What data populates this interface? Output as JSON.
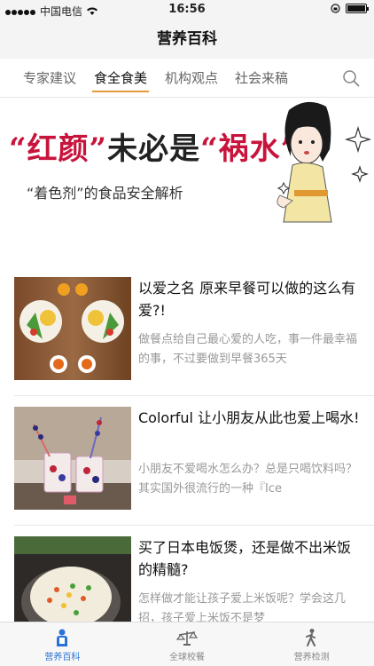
{
  "status_bar": {
    "carrier": "中国电信",
    "time": "16:56"
  },
  "nav": {
    "title": "营养百科"
  },
  "tabs": [
    {
      "label": "专家建议"
    },
    {
      "label": "食全食美"
    },
    {
      "label": "机构观点"
    },
    {
      "label": "社会来稿"
    }
  ],
  "banner": {
    "title_part1": "“红颜”",
    "title_part2": "未必是",
    "title_part3": "“祸水”",
    "subtitle": "“着色剂”的食品安全解析"
  },
  "articles": [
    {
      "title": "以爱之名 原来早餐可以做的这么有爱?!",
      "desc": "做餐点给自己最心爱的人吃，事一件最幸福的事，不过要做到早餐365天"
    },
    {
      "title": "Colorful 让小朋友从此也爱上喝水!",
      "desc": "小朋友不爱喝水怎么办？总是只喝饮料吗？其实国外很流行的一种『Ice"
    },
    {
      "title": "买了日本电饭煲，还是做不出米饭的精髓?",
      "desc": "怎样做才能让孩子爱上米饭呢？学会这几招，孩子爱上米饭不是梦"
    }
  ],
  "bottom_tabs": [
    {
      "label": "营养百科",
      "icon": "person-icon"
    },
    {
      "label": "全球校餐",
      "icon": "scale-icon"
    },
    {
      "label": "营养检测",
      "icon": "walker-icon"
    }
  ],
  "colors": {
    "accent": "#e29a3a",
    "active_tab": "#2a72d6",
    "banner_red": "#c8143c"
  }
}
